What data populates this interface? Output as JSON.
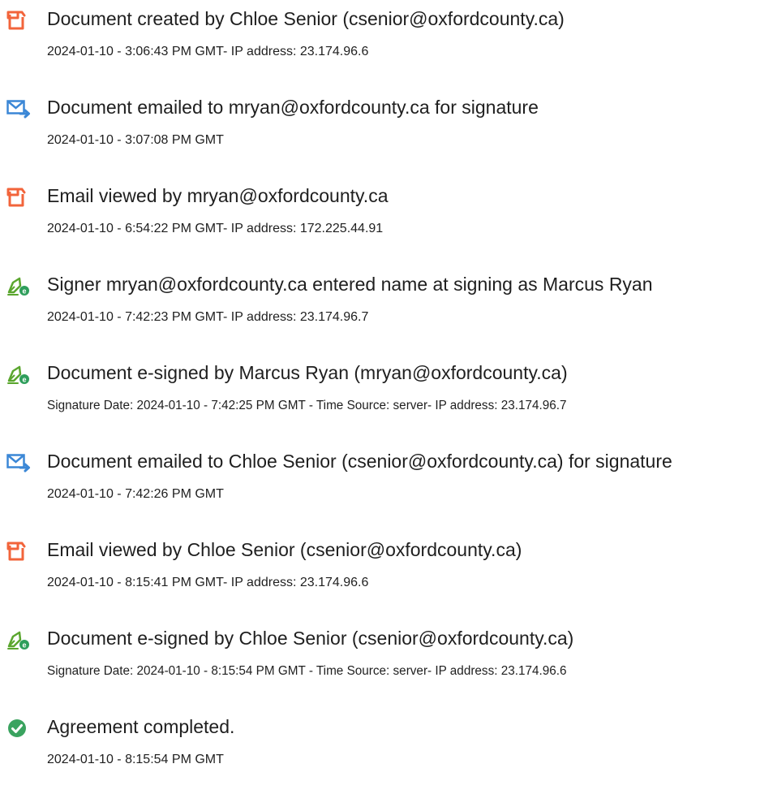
{
  "events": [
    {
      "icon": "document-icon",
      "title": "Document created by Chloe Senior (csenior@oxfordcounty.ca)",
      "detail": "2024-01-10 - 3:06:43 PM GMT- IP address: 23.174.96.6"
    },
    {
      "icon": "email-send-icon",
      "title": "Document emailed to mryan@oxfordcounty.ca for signature",
      "detail": "2024-01-10 - 3:07:08 PM GMT"
    },
    {
      "icon": "document-icon",
      "title": "Email viewed by mryan@oxfordcounty.ca",
      "detail": "2024-01-10 - 6:54:22 PM GMT- IP address: 172.225.44.91"
    },
    {
      "icon": "esign-pen-icon",
      "title": "Signer mryan@oxfordcounty.ca entered name at signing as Marcus Ryan",
      "detail": "2024-01-10 - 7:42:23 PM GMT- IP address: 23.174.96.7"
    },
    {
      "icon": "esign-pen-icon",
      "title": "Document e-signed by Marcus Ryan (mryan@oxfordcounty.ca)",
      "detail": "Signature Date: 2024-01-10 - 7:42:25 PM GMT - Time Source: server- IP address: 23.174.96.7"
    },
    {
      "icon": "email-send-icon",
      "title": "Document emailed to Chloe Senior (csenior@oxfordcounty.ca) for signature",
      "detail": "2024-01-10 - 7:42:26 PM GMT"
    },
    {
      "icon": "document-icon",
      "title": "Email viewed by Chloe Senior (csenior@oxfordcounty.ca)",
      "detail": "2024-01-10 - 8:15:41 PM GMT- IP address: 23.174.96.6"
    },
    {
      "icon": "esign-pen-icon",
      "title": "Document e-signed by Chloe Senior (csenior@oxfordcounty.ca)",
      "detail": "Signature Date: 2024-01-10 - 8:15:54 PM GMT - Time Source: server- IP address: 23.174.96.6"
    },
    {
      "icon": "check-circle-icon",
      "title": "Agreement completed.",
      "detail": "2024-01-10 - 8:15:54 PM GMT"
    }
  ],
  "colors": {
    "document_icon": "#f2643b",
    "email_icon": "#3b87d6",
    "pen_icon": "#5aa62e",
    "badge_icon": "#2e9e5b",
    "check_icon": "#3aa35f",
    "text": "#1f1f1f"
  }
}
